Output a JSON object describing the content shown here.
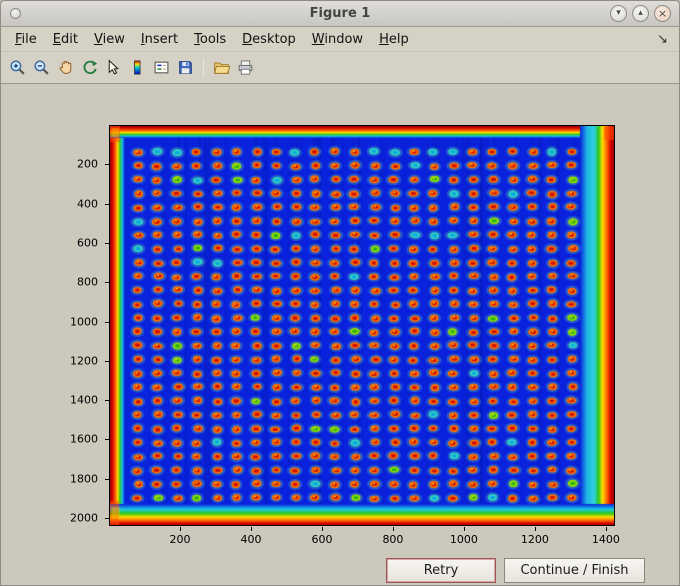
{
  "window": {
    "title": "Figure 1",
    "controls": {
      "shade_glyph": "▾",
      "maximize_glyph": "▴",
      "close_glyph": "×"
    }
  },
  "menubar": {
    "items": [
      {
        "label": "File"
      },
      {
        "label": "Edit"
      },
      {
        "label": "View"
      },
      {
        "label": "Insert"
      },
      {
        "label": "Tools"
      },
      {
        "label": "Desktop"
      },
      {
        "label": "Window"
      },
      {
        "label": "Help"
      }
    ],
    "dock_glyph": "↘"
  },
  "toolbar": {
    "icons": [
      "zoom-in",
      "zoom-out",
      "pan",
      "rotate-3d",
      "data-cursor",
      "insert-colorbar",
      "insert-legend",
      "save",
      "open",
      "print"
    ]
  },
  "action_buttons": {
    "retry": "Retry",
    "continue": "Continue / Finish"
  },
  "chart_data": {
    "type": "heatmap",
    "title": "",
    "description": "Jet-colormap pseudocolor scan of a spotted well plate: regular grid of warm red/orange spots on a blue background, hot red/orange borders on all four plate edges and a cyan band just inside the right edge",
    "x_ticks": [
      200,
      400,
      600,
      800,
      1000,
      1200,
      1400
    ],
    "y_ticks": [
      200,
      400,
      600,
      800,
      1000,
      1200,
      1400,
      1600,
      1800,
      2000
    ],
    "x_range": [
      0,
      1420
    ],
    "y_range": [
      0,
      2030
    ],
    "grid": {
      "rows": 26,
      "cols": 23
    },
    "colors": {
      "background": "#0a22dd",
      "spot_rim": "#ff7300",
      "spot_core": "#cf1500",
      "spot_glint": "#ffd800",
      "halo": "rgba(100,230,180,0.28)",
      "edge_hot": "#d80000",
      "edge_warm": "#ff7000",
      "edge_yellow": "#ffe000",
      "edge_green": "#2fc818",
      "edge_cyan": "#19c9e8"
    },
    "seed": 987654
  }
}
